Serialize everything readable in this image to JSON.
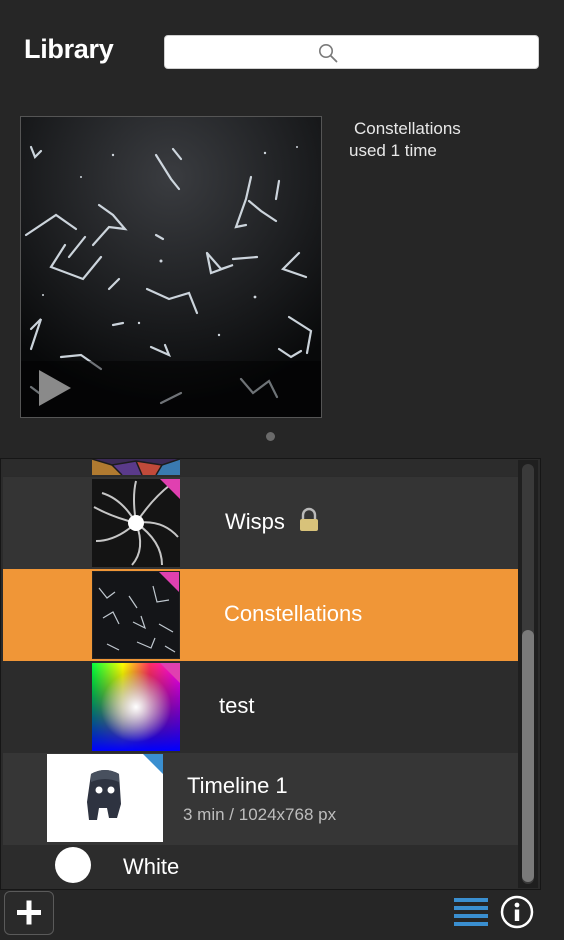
{
  "header": {
    "title": "Library",
    "search_value": "",
    "search_placeholder": ""
  },
  "preview": {
    "name": "Constellations",
    "usage": "used 1 time"
  },
  "list": {
    "items": [
      {
        "label": "",
        "sub": "",
        "locked": false,
        "selected": false,
        "thumb": "stained-glass",
        "corner": "#d040a0"
      },
      {
        "label": "Wisps",
        "sub": "",
        "locked": true,
        "selected": false,
        "thumb": "wisps",
        "corner": "#e040b0"
      },
      {
        "label": "Constellations",
        "sub": "",
        "locked": false,
        "selected": true,
        "thumb": "constellations",
        "corner": "#e040b0"
      },
      {
        "label": "test",
        "sub": "",
        "locked": false,
        "selected": false,
        "thumb": "color-gradient",
        "corner": "#e040b0"
      },
      {
        "label": "Timeline 1",
        "sub": "3 min / 1024x768 px",
        "locked": false,
        "selected": false,
        "thumb": "figure",
        "corner": "#3a8fd0"
      },
      {
        "label": "White",
        "sub": "",
        "locked": false,
        "selected": false,
        "thumb": "white-circle",
        "corner": ""
      }
    ]
  },
  "colors": {
    "background": "#262626",
    "selected_row": "#f09637",
    "accent_blue": "#3a8fd0",
    "accent_pink": "#e040b0"
  },
  "icons": {
    "search": "magnifier-icon",
    "play": "play-icon",
    "lock": "lock-icon",
    "add": "plus-icon",
    "list_view": "list-view-icon",
    "info": "info-icon"
  }
}
